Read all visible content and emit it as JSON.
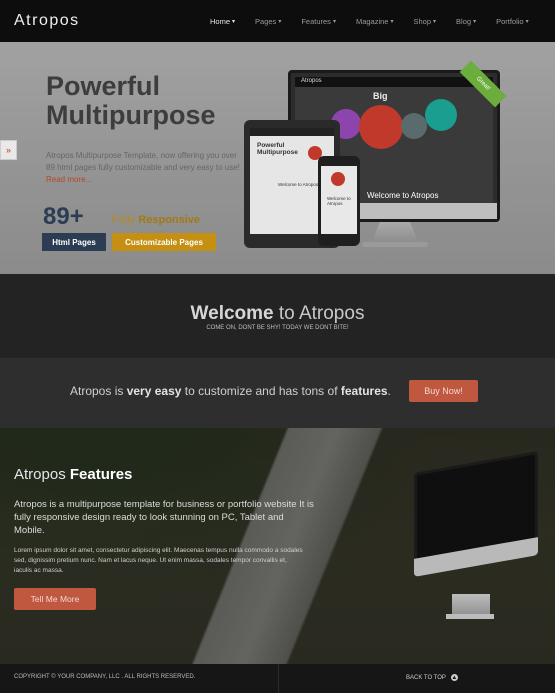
{
  "nav": {
    "logo": "Atropos",
    "items": [
      {
        "label": "Home",
        "active": true
      },
      {
        "label": "Pages"
      },
      {
        "label": "Features"
      },
      {
        "label": "Magazine"
      },
      {
        "label": "Shop"
      },
      {
        "label": "Blog"
      },
      {
        "label": "Portfolio"
      }
    ]
  },
  "hero": {
    "title_line1": "Powerful",
    "title_line2": "Multipurpose",
    "description": "Atropos Multipurpose Template, now offering you over 89 html pages fully customizable and very easy to use!",
    "read_more": "Read more...",
    "big_number": "89+",
    "fully_prefix": "Fully",
    "fully_strong": "Responsive",
    "badge_pages": "Html Pages",
    "badge_custom": "Customizable Pages",
    "ribbon": "Great!",
    "device_brand": "Atropos",
    "device_big": "Big",
    "device_welcome": "Welcome to Atropos",
    "tablet_title_line1": "Powerful",
    "tablet_title_line2": "Multipurpose",
    "tablet_welcome": "Welcome to Atropos",
    "phone_welcome": "Welcome to Atropos"
  },
  "welcome": {
    "title_strong": "Welcome",
    "title_rest": " to Atropos",
    "subtitle": "COME ON, DONT BE SHY! TODAY WE DONT BITE!"
  },
  "cta": {
    "text_1": "Atropos is ",
    "text_strong_1": "very easy",
    "text_2": " to customize and has tons of ",
    "text_strong_2": "features",
    "text_3": ".",
    "button": "Buy Now!"
  },
  "features": {
    "title_1": "Atropos ",
    "title_strong": "Features",
    "paragraph_1": "Atropos is a multipurpose template for business or portfolio website It is fully responsive design ready to look stunning on PC, Tablet and Mobile.",
    "paragraph_2": "Lorem ipsum dolor sit amet, consectetur adipiscing elit. Maecenas tempus nulla commodo a sodales sed, dignissim pretium nunc. Nam et lacus neque. Ut enim massa, sodales tempor convallis et, iaculis ac massa.",
    "button": "Tell Me More"
  },
  "footer": {
    "copyright": "COPYRIGHT © YOUR COMPANY, LLC . ALL RIGHTS RESERVED.",
    "back_to_top": "BACK TO TOP"
  },
  "colors": {
    "accent": "#c0573f",
    "navy": "#2b3c53",
    "gold": "#c48f12"
  }
}
